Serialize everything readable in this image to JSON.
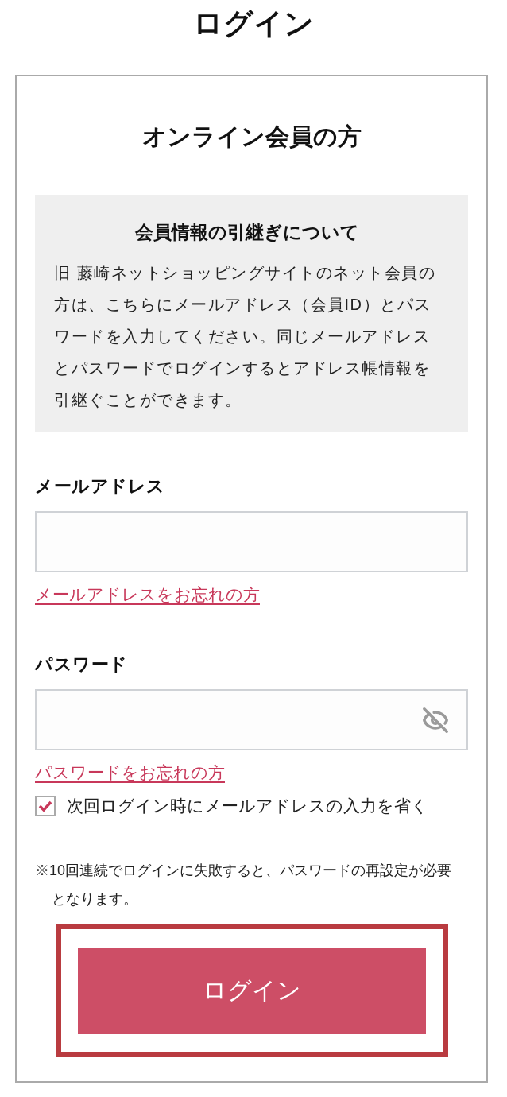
{
  "page_title": "ログイン",
  "card": {
    "title": "オンライン会員の方"
  },
  "notice": {
    "title": "会員情報の引継ぎについて",
    "body": "旧 藤崎ネットショッピングサイトのネット会員の方は、こちらにメールアドレス（会員ID）とパスワードを入力してください。同じメールアドレスとパスワードでログインするとアドレス帳情報を引継ぐことができます。"
  },
  "fields": [
    {
      "kind": "email",
      "label": "メールアドレス",
      "link": "メールアドレスをお忘れの方"
    },
    {
      "kind": "password",
      "label": "パスワード",
      "link": "パスワードをお忘れの方",
      "show_password": false
    }
  ],
  "remember": {
    "label": "次回ログイン時にメールアドレスの入力を省く",
    "checked": true
  },
  "note": "※10回連続でログインに失敗すると、パスワードの再設定が必要となります。",
  "login_button": {
    "label": "ログイン",
    "highlighted": true
  }
}
